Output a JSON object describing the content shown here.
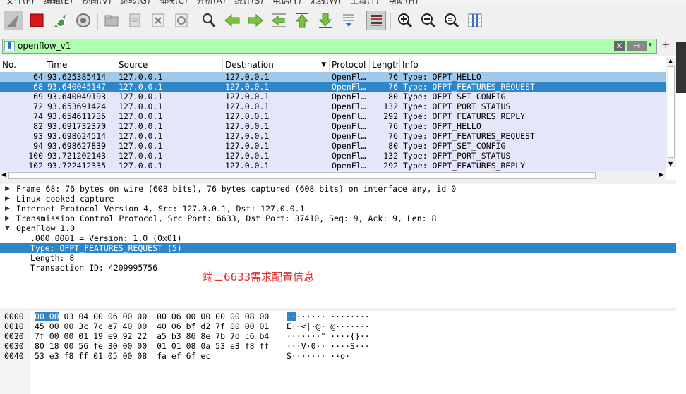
{
  "menu": [
    "文件(F)",
    "编辑(E)",
    "视图(V)",
    "跳转(G)",
    "捕获(C)",
    "分析(A)",
    "统计(S)",
    "电话(Y)",
    "无线(W)",
    "工具(T)",
    "帮助(H)"
  ],
  "filter": {
    "value": "openflow_v1",
    "clear_label": "✕",
    "apply_label": "⇨",
    "dropdown_label": "▾",
    "add_label": "+"
  },
  "columns": [
    "No.",
    "Time",
    "Source",
    "Destination",
    "Protocol",
    "Length",
    "Info"
  ],
  "packets": [
    {
      "no": "64",
      "time": "93.625385414",
      "src": "127.0.0.1",
      "dst": "127.0.0.1",
      "proto": "OpenFl…",
      "len": "76",
      "info": "Type: OFPT_HELLO"
    },
    {
      "no": "68",
      "time": "93.640045147",
      "src": "127.0.0.1",
      "dst": "127.0.0.1",
      "proto": "OpenFl…",
      "len": "76",
      "info": "Type: OFPT_FEATURES_REQUEST"
    },
    {
      "no": "69",
      "time": "93.640049193",
      "src": "127.0.0.1",
      "dst": "127.0.0.1",
      "proto": "OpenFl…",
      "len": "80",
      "info": "Type: OFPT_SET_CONFIG"
    },
    {
      "no": "72",
      "time": "93.653691424",
      "src": "127.0.0.1",
      "dst": "127.0.0.1",
      "proto": "OpenFl…",
      "len": "132",
      "info": "Type: OFPT_PORT_STATUS"
    },
    {
      "no": "74",
      "time": "93.654611735",
      "src": "127.0.0.1",
      "dst": "127.0.0.1",
      "proto": "OpenFl…",
      "len": "292",
      "info": "Type: OFPT_FEATURES_REPLY"
    },
    {
      "no": "82",
      "time": "93.691732370",
      "src": "127.0.0.1",
      "dst": "127.0.0.1",
      "proto": "OpenFl…",
      "len": "76",
      "info": "Type: OFPT_HELLO"
    },
    {
      "no": "93",
      "time": "93.698624514",
      "src": "127.0.0.1",
      "dst": "127.0.0.1",
      "proto": "OpenFl…",
      "len": "76",
      "info": "Type: OFPT_FEATURES_REQUEST"
    },
    {
      "no": "94",
      "time": "93.698627839",
      "src": "127.0.0.1",
      "dst": "127.0.0.1",
      "proto": "OpenFl…",
      "len": "80",
      "info": "Type: OFPT_SET_CONFIG"
    },
    {
      "no": "100",
      "time": "93.721202143",
      "src": "127.0.0.1",
      "dst": "127.0.0.1",
      "proto": "OpenFl…",
      "len": "132",
      "info": "Type: OFPT_PORT_STATUS"
    },
    {
      "no": "102",
      "time": "93.722412335",
      "src": "127.0.0.1",
      "dst": "127.0.0.1",
      "proto": "OpenFl…",
      "len": "292",
      "info": "Type: OFPT_FEATURES_REPLY"
    }
  ],
  "selected_packet": "68",
  "details": [
    "Frame 68: 76 bytes on wire (608 bits), 76 bytes captured (608 bits) on interface any, id 0",
    "Linux cooked capture",
    "Internet Protocol Version 4, Src: 127.0.0.1, Dst: 127.0.0.1",
    "Transmission Control Protocol, Src Port: 6633, Dst Port: 37410, Seq: 9, Ack: 9, Len: 8",
    "OpenFlow 1.0",
    ".000 0001 = Version: 1.0 (0x01)",
    "Type: OFPT_FEATURES_REQUEST (5)",
    "Length: 8",
    "Transaction ID: 4209995756"
  ],
  "annotation": "端口6633需求配置信息",
  "bytes": [
    {
      "offset": "0000",
      "hex_a": "00 00",
      "hex_b": " 03 04 00 06 00 00  00 06 00 00 00 00 08 00",
      "ascii_a": "··",
      "ascii_b": "······ ········"
    },
    {
      "offset": "0010",
      "hex_a": "",
      "hex_b": "45 00 00 3c 7c e7 40 00  40 06 bf d2 7f 00 00 01",
      "ascii_a": "",
      "ascii_b": "E··<|·@· @·······"
    },
    {
      "offset": "0020",
      "hex_a": "",
      "hex_b": "7f 00 00 01 19 e9 92 22  a5 b3 86 8e 7b 7d c6 b4",
      "ascii_a": "",
      "ascii_b": "·······\" ····{}··"
    },
    {
      "offset": "0030",
      "hex_a": "",
      "hex_b": "80 18 00 56 fe 30 00 00  01 01 08 0a 53 e3 f8 ff",
      "ascii_a": "",
      "ascii_b": "···V·0·· ····S···"
    },
    {
      "offset": "0040",
      "hex_a": "",
      "hex_b": "53 e3 f8 ff 01 05 00 08  fa ef 6f ec",
      "ascii_a": "",
      "ascii_b": "S······· ··o·"
    }
  ],
  "colors": {
    "row_bg": "#e6e6fa",
    "row_first": "#a0c8e8",
    "selected": "#2e86c8",
    "filter_ok": "#afffaf",
    "annotation": "#e03030"
  }
}
